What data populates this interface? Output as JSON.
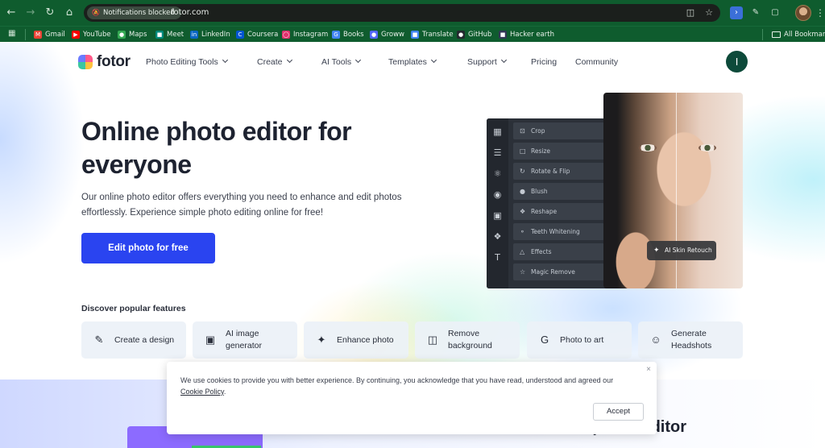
{
  "browser": {
    "notification_chip": "Notifications blocked",
    "url": "fotor.com",
    "bookmarks": [
      {
        "label": "Gmail",
        "icon": "gmail-icon",
        "color": "#ea4335"
      },
      {
        "label": "YouTube",
        "icon": "youtube-icon",
        "color": "#ff0000"
      },
      {
        "label": "Maps",
        "icon": "maps-icon",
        "color": "#34a853"
      },
      {
        "label": "Meet",
        "icon": "meet-icon",
        "color": "#00897b"
      },
      {
        "label": "LinkedIn",
        "icon": "linkedin-icon",
        "color": "#0a66c2"
      },
      {
        "label": "Coursera",
        "icon": "coursera-icon",
        "color": "#0056d2"
      },
      {
        "label": "Instagram",
        "icon": "instagram-icon",
        "color": "#e1306c"
      },
      {
        "label": "Books",
        "icon": "google-icon",
        "color": "#4285f4"
      },
      {
        "label": "Groww",
        "icon": "groww-icon",
        "color": "#5367ff"
      },
      {
        "label": "Translate",
        "icon": "translate-icon",
        "color": "#4285f4"
      },
      {
        "label": "GitHub",
        "icon": "github-icon",
        "color": "#24292f"
      },
      {
        "label": "Hacker earth",
        "icon": "hackerearth-icon",
        "color": "#323754"
      }
    ],
    "all_bookmarks": "All Bookmarks"
  },
  "site": {
    "brand": "fotor",
    "nav": [
      {
        "label": "Photo Editing Tools",
        "dropdown": true
      },
      {
        "label": "Create",
        "dropdown": true
      },
      {
        "label": "AI Tools",
        "dropdown": true
      },
      {
        "label": "Templates",
        "dropdown": true
      },
      {
        "label": "Support",
        "dropdown": true
      },
      {
        "label": "Pricing",
        "dropdown": false
      },
      {
        "label": "Community",
        "dropdown": false
      }
    ],
    "user_initial": "I"
  },
  "hero": {
    "title": "Online photo editor for everyone",
    "description": "Our online photo editor offers everything you need to enhance and edit photos effortlessly. Experience simple photo editing online for free!",
    "cta": "Edit photo for free",
    "cta_color": "#2a44f0"
  },
  "editor_mock": {
    "tools": [
      "Crop",
      "Resize",
      "Rotate & Flip",
      "Blush",
      "Reshape",
      "Teeth Whitening",
      "Effects",
      "Magic Remove"
    ],
    "badge": "AI Skin Retouch"
  },
  "features": {
    "title": "Discover popular features",
    "items": [
      {
        "label": "Create a design",
        "icon": "magic-pen-icon"
      },
      {
        "label": "AI image generator",
        "icon": "ai-image-icon"
      },
      {
        "label": "Enhance photo",
        "icon": "enhance-icon"
      },
      {
        "label": "Remove background",
        "icon": "remove-bg-icon"
      },
      {
        "label": "Photo to art",
        "icon": "art-icon"
      },
      {
        "label": "Generate Headshots",
        "icon": "headshot-icon"
      }
    ]
  },
  "section2": {
    "title": "...ur online photo editor"
  },
  "cookie": {
    "text_before": "We use cookies to provide you with better experience. By continuing, you acknowledge that you have read, understood and agreed our ",
    "link": "Cookie Policy",
    "text_after": ".",
    "accept": "Accept"
  }
}
